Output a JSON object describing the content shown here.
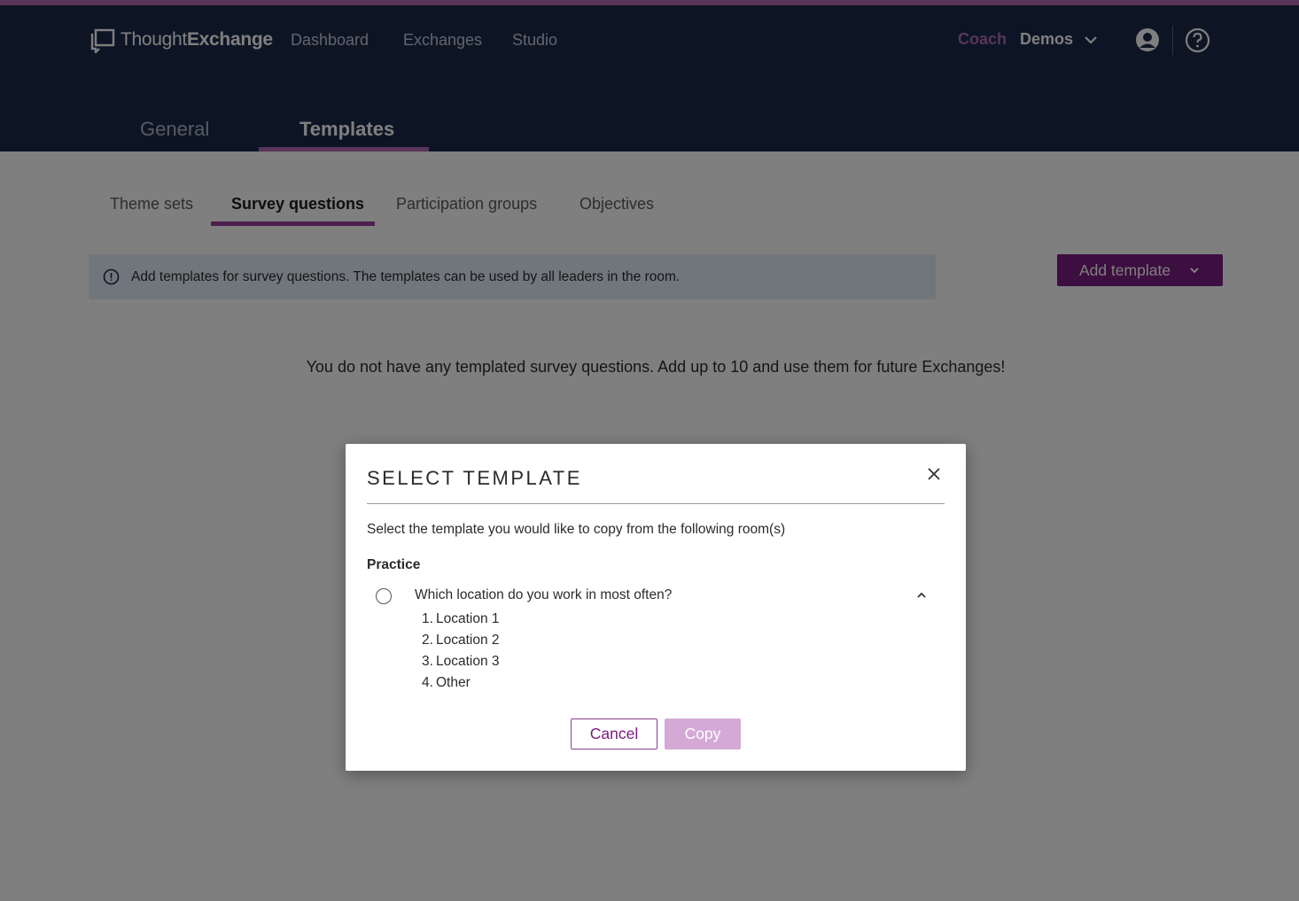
{
  "header": {
    "brand_light": "Thought",
    "brand_bold": "Exchange",
    "nav": [
      "Dashboard",
      "Exchanges",
      "Studio"
    ],
    "role": "Coach",
    "org": "Demos",
    "accent_color": "#b06bb3"
  },
  "main_tabs": [
    {
      "label": "General",
      "active": false
    },
    {
      "label": "Templates",
      "active": true
    }
  ],
  "sub_tabs": [
    {
      "label": "Theme sets",
      "active": false
    },
    {
      "label": "Survey questions",
      "active": true
    },
    {
      "label": "Participation groups",
      "active": false
    },
    {
      "label": "Objectives",
      "active": false
    }
  ],
  "info_banner": {
    "text": "Add templates for survey questions. The templates can be used by all leaders in the room."
  },
  "add_template_button": "Add template",
  "empty_message": "You do not have any templated survey questions. Add up to 10 and use them for future Exchanges!",
  "modal": {
    "title": "SELECT TEMPLATE",
    "description": "Select the template you would like to copy from the following room(s)",
    "room": "Practice",
    "question": "Which location do you work in most often?",
    "options": [
      {
        "num": "1.",
        "label": "Location 1"
      },
      {
        "num": "2.",
        "label": "Location 2"
      },
      {
        "num": "3.",
        "label": "Location 3"
      },
      {
        "num": "4.",
        "label": "Other"
      }
    ],
    "cancel_label": "Cancel",
    "copy_label": "Copy",
    "primary_color": "#7b1c81"
  },
  "icons": {
    "logo": "thoughtexchange-logo-icon",
    "org_dropdown": "chevron-down-icon",
    "profile": "user-circle-icon",
    "help": "help-circle-icon",
    "info": "info-circle-icon",
    "close": "close-icon",
    "collapse": "chevron-up-icon"
  }
}
